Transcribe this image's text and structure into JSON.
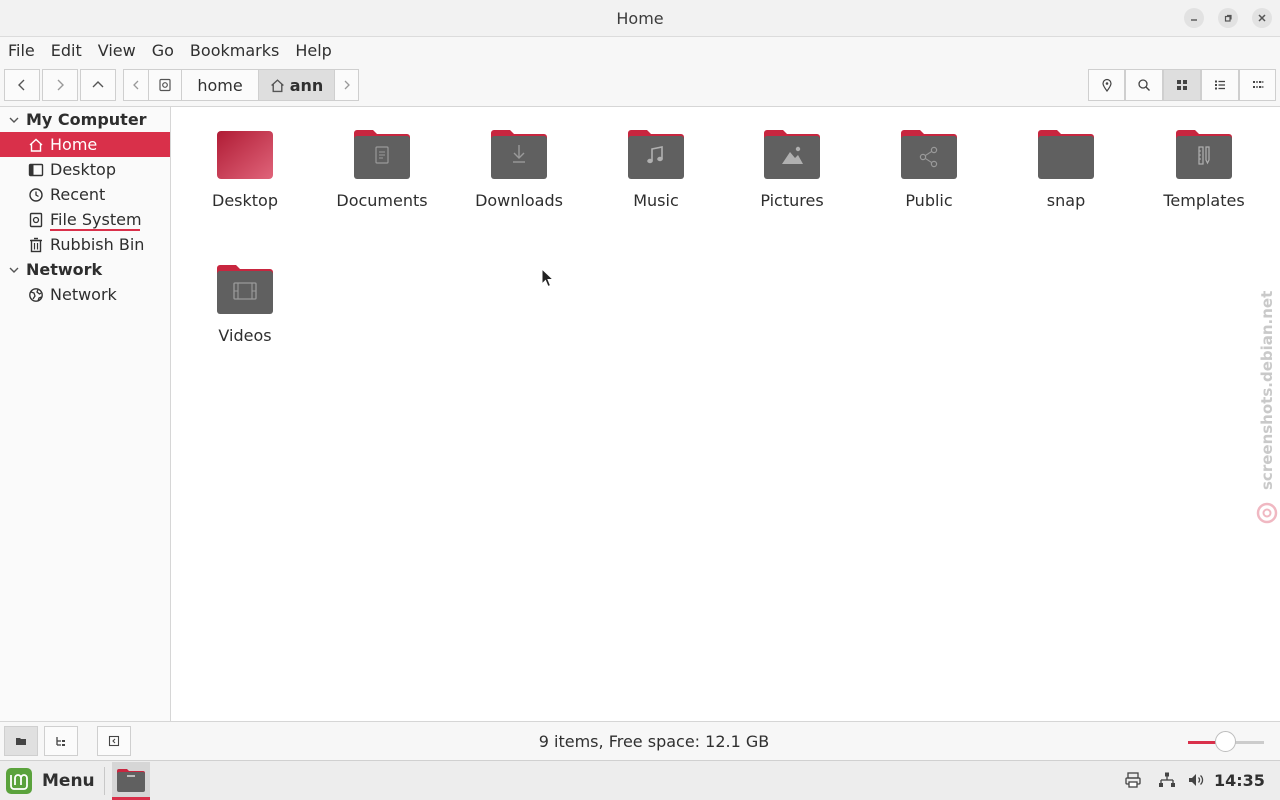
{
  "window": {
    "title": "Home"
  },
  "menubar": {
    "items": [
      "File",
      "Edit",
      "View",
      "Go",
      "Bookmarks",
      "Help"
    ]
  },
  "breadcrumb": {
    "parts": [
      "home",
      "ann"
    ]
  },
  "sidebar": {
    "sections": [
      {
        "title": "My Computer",
        "items": [
          "Home",
          "Desktop",
          "Recent",
          "File System",
          "Rubbish Bin"
        ]
      },
      {
        "title": "Network",
        "items": [
          "Network"
        ]
      }
    ],
    "selected": "Home"
  },
  "files": [
    {
      "name": "Desktop",
      "icon": "desktop-folder-icon"
    },
    {
      "name": "Documents",
      "icon": "documents-folder-icon"
    },
    {
      "name": "Downloads",
      "icon": "downloads-folder-icon"
    },
    {
      "name": "Music",
      "icon": "music-folder-icon"
    },
    {
      "name": "Pictures",
      "icon": "pictures-folder-icon"
    },
    {
      "name": "Public",
      "icon": "public-folder-icon"
    },
    {
      "name": "snap",
      "icon": "folder-icon"
    },
    {
      "name": "Templates",
      "icon": "templates-folder-icon"
    },
    {
      "name": "Videos",
      "icon": "videos-folder-icon"
    }
  ],
  "statusbar": {
    "text": "9 items, Free space: 12.1 GB",
    "zoom_level": 0.45
  },
  "taskbar": {
    "menu_label": "Menu",
    "clock": "14:35"
  },
  "watermark": {
    "text": "screenshots.debian.net"
  },
  "colors": {
    "accent": "#d9304a",
    "folder_body": "#606060",
    "folder_tab": "#c8263f"
  }
}
